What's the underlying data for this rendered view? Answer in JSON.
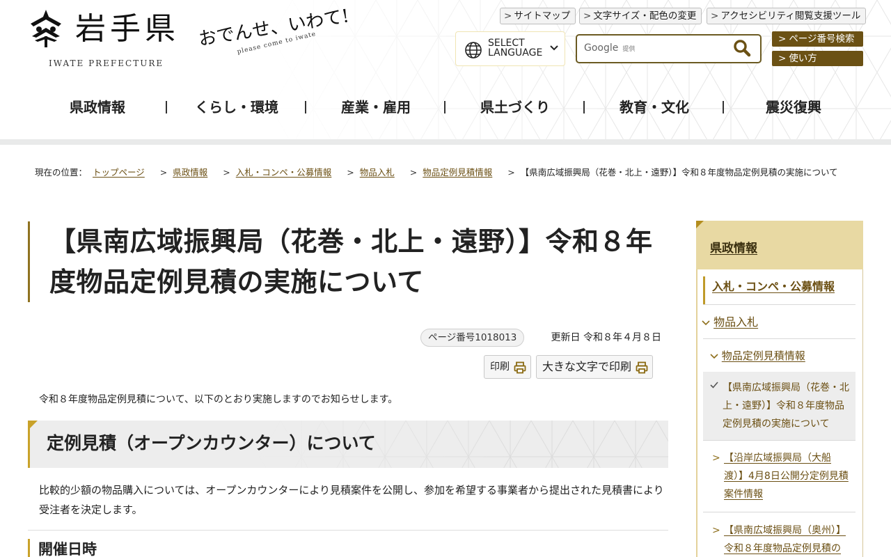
{
  "header": {
    "logo_name": "岩手県",
    "logo_en": "IWATE PREFECTURE",
    "tagline": "おでんせ、いわて!",
    "tagline_sub": "please come to iwate",
    "utility_links": [
      "サイトマップ",
      "文字サイズ・配色の変更",
      "アクセシビリティ閲覧支援ツール"
    ],
    "language_label_1": "SELECT",
    "language_label_2": "LANGUAGE",
    "search_brand": "Google",
    "search_brand_sub": "提供",
    "search_value": "",
    "page_number_search": "ページ番号検索",
    "how_to_use": "使い方"
  },
  "global_nav": [
    "県政情報",
    "くらし・環境",
    "産業・雇用",
    "県土づくり",
    "教育・文化",
    "震災復興"
  ],
  "breadcrumb": {
    "label": "現在の位置：",
    "items": [
      "トップページ",
      "県政情報",
      "入札・コンペ・公募情報",
      "物品入札",
      "物品定例見積情報"
    ],
    "current": "【県南広域振興局（花巻・北上・遠野）】令和８年度物品定例見積の実施について",
    "separator": ">"
  },
  "main": {
    "title": "【県南広域振興局（花巻・北上・遠野）】令和８年度物品定例見積の実施について",
    "page_number": "ページ番号1018013",
    "updated": "更新日 令和８年４月８日",
    "print_label": "印刷",
    "print_large_label": "大きな文字で印刷",
    "intro": "令和８年度物品定例見積について、以下のとおり実施しますのでお知らせします。",
    "h2": "定例見積（オープンカウンター）について",
    "body": "比較的少額の物品購入については、オープンカウンターにより見積案件を公開し、参加を希望する事業者から提出された見積書により受注者を決定します。",
    "h3": "開催日時"
  },
  "sidenav": {
    "heading": "県政情報",
    "level1": "入札・コンペ・公募情報",
    "level2": "物品入札",
    "level3": "物品定例見積情報",
    "current": "【県南広域振興局（花巻・北上・遠野）】令和８年度物品定例見積の実施について",
    "siblings": [
      "【沿岸広域振興局（大船渡）】4月8日公開分定例見積案件情報",
      "【県南広域振興局（奥州）】令和８年度物品定例見積の"
    ]
  },
  "colors": {
    "accent": "#8f7220",
    "button_brown": "#6b5114",
    "link": "#6b4f13",
    "side_head": "#e8d9a3"
  }
}
